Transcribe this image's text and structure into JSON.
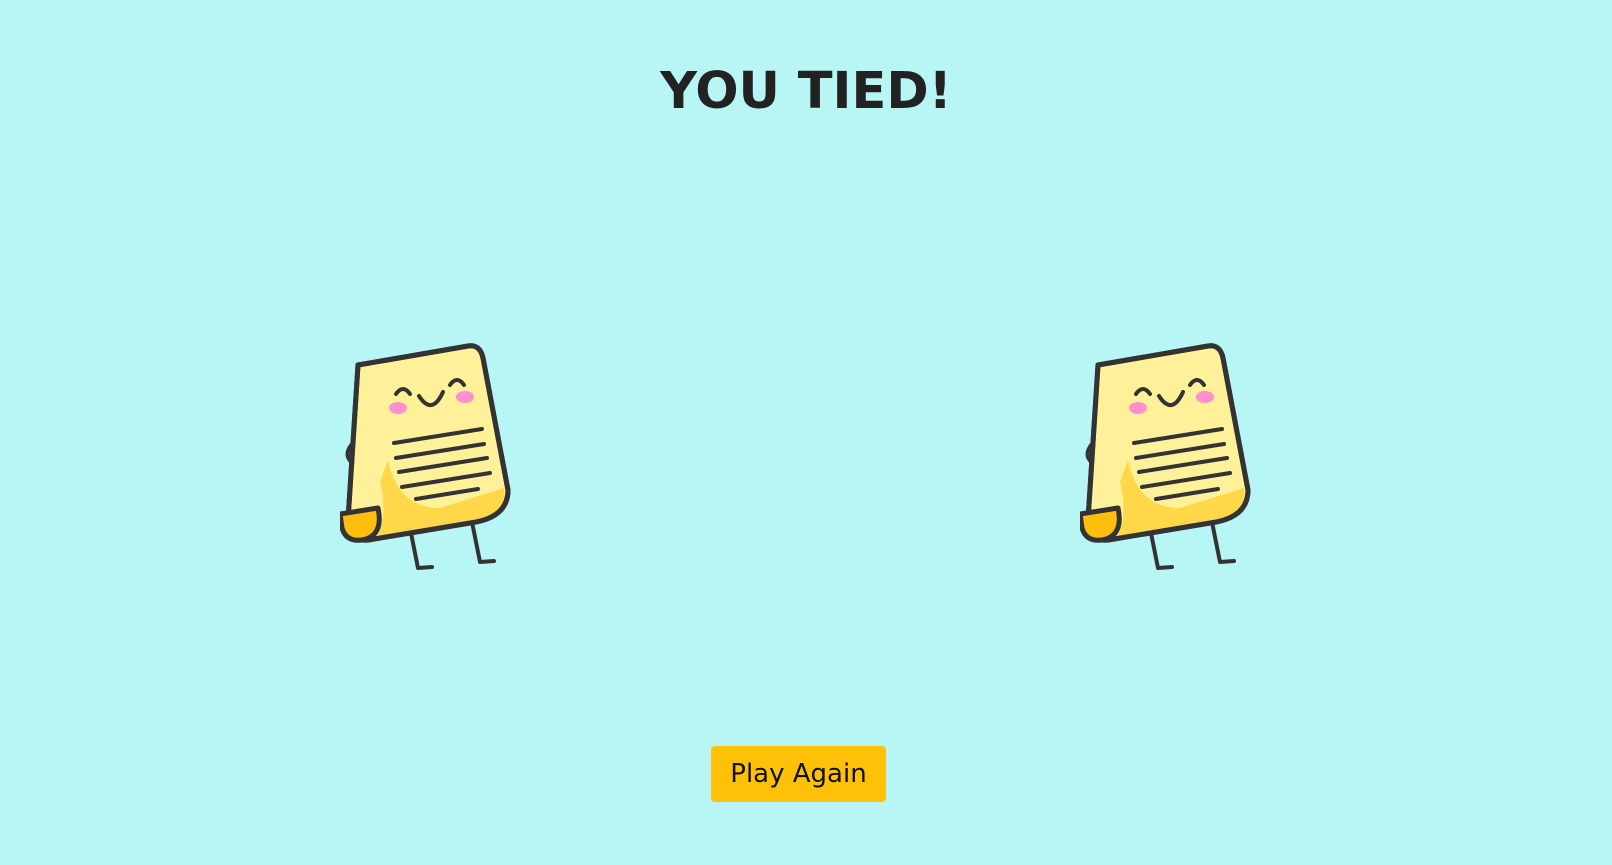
{
  "result": {
    "title": "YOU TIED!"
  },
  "choices": {
    "player": {
      "icon": "paper-icon"
    },
    "opponent": {
      "icon": "paper-icon"
    }
  },
  "actions": {
    "play_again_label": "Play Again"
  },
  "colors": {
    "background": "#b7f6f4",
    "button": "#ffc107",
    "paper_light": "#fff09a",
    "paper_dark": "#ffd84a",
    "paper_fold": "#ffbd0d",
    "blush": "#ff8fcf",
    "outline": "#333333"
  }
}
